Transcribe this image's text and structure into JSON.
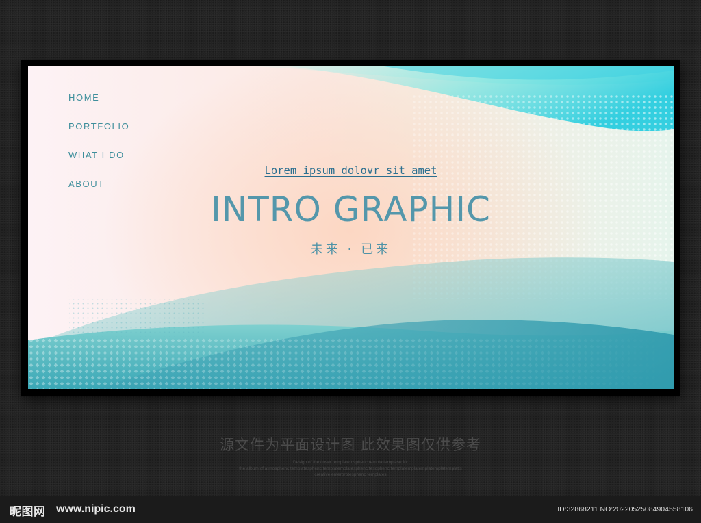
{
  "nav": {
    "items": [
      {
        "label": "HOME"
      },
      {
        "label": "PORTFOLIO"
      },
      {
        "label": "WHAT I DO"
      },
      {
        "label": "ABOUT"
      }
    ]
  },
  "hero": {
    "subtitle": "Lorem ipsum dolovr sit amet",
    "title": "INTRO GRAPHIC",
    "chinese_subtitle": "未来 · 已来"
  },
  "caption": {
    "main": "源文件为平面设计图 此效果图仅供参考",
    "line1": "Design of the cover templatetnsphenc templattemplase for",
    "line2": "the album of atmosphenc templatesphenc templatemplatesphenc tesophenc templatemplatemplatemplatemplatis",
    "line3": "creative enterprotesphenc templates"
  },
  "watermark": {
    "logo": "昵图网",
    "site": "www.nipic.com",
    "id": "ID:32868211 NO:20220525084904558106"
  },
  "colors": {
    "accent": "#3f8f9c",
    "title": "#5497ab",
    "teal_dark": "#3aa3b8",
    "teal_light": "#7de8e4"
  }
}
